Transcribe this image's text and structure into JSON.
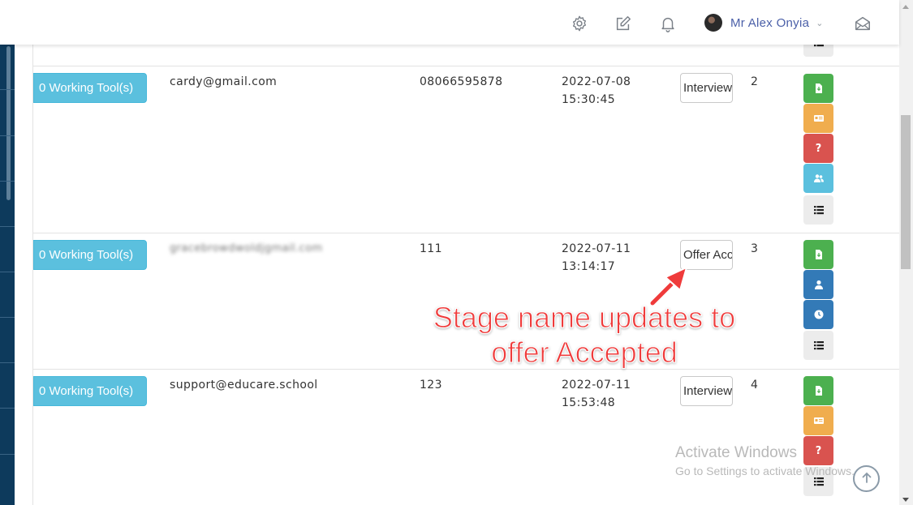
{
  "header": {
    "icons": [
      "gear-icon",
      "edit-icon",
      "bell-icon",
      "mail-open-icon"
    ],
    "user_name": "Mr Alex Onyia"
  },
  "rows": [
    {
      "tools_label": "0 Working Tool(s)",
      "email": "cardy@gmail.com",
      "phone": "08066595878",
      "date": "2022-07-08",
      "time": "15:30:45",
      "stage": "Interview",
      "number": "2",
      "actions": [
        "download-file",
        "id-card",
        "question",
        "users",
        "list"
      ]
    },
    {
      "tools_label": "0 Working Tool(s)",
      "email": "gracebrowdwoldjgmail.com",
      "phone": "111",
      "date": "2022-07-11",
      "time": "13:14:17",
      "stage": "Offer Accepted",
      "number": "3",
      "actions": [
        "download-file",
        "user",
        "clock",
        "list"
      ]
    },
    {
      "tools_label": "0 Working Tool(s)",
      "email": "support@educare.school",
      "phone": "123",
      "date": "2022-07-11",
      "time": "15:53:48",
      "stage": "Interview",
      "number": "4",
      "actions": [
        "download-file",
        "id-card",
        "question",
        "list"
      ]
    }
  ],
  "annotation": {
    "line1": "Stage name updates to",
    "line2": "offer Accepted",
    "color": "#ef3b3b"
  },
  "watermark": {
    "title": "Activate Windows",
    "subtitle": "Go to Settings to activate Windows."
  },
  "colors": {
    "info": "#5bc0de",
    "success": "#4cb04f",
    "warning": "#f0ad4e",
    "danger": "#d9534f",
    "primary": "#337ab7",
    "sidebar": "#0d3a5c"
  }
}
